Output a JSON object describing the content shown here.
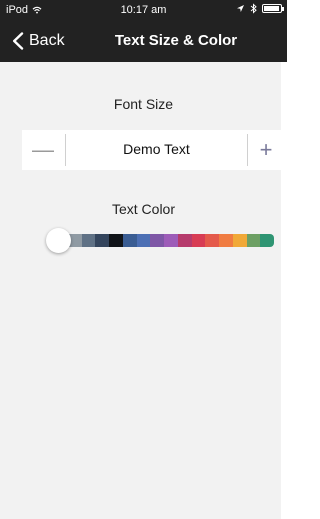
{
  "status_bar": {
    "carrier": "iPod",
    "time": "10:17 am",
    "wifi_icon": "wifi-icon",
    "location_icon": "location-arrow-icon",
    "bluetooth_icon": "bluetooth-icon",
    "battery_icon": "battery-icon"
  },
  "nav_bar": {
    "back_label": "Back",
    "back_icon": "chevron-left-icon",
    "title": "Text Size & Color"
  },
  "font_size": {
    "label": "Font Size",
    "decrease_label": "—",
    "demo_text": "Demo Text",
    "increase_label": "+"
  },
  "text_color": {
    "label": "Text Color",
    "selected_index": 0,
    "swatches": [
      "#cfd2d3",
      "#8f9aa3",
      "#5f7185",
      "#34455d",
      "#111419",
      "#3a5d93",
      "#4c6fb4",
      "#7e57a6",
      "#9d5cb8",
      "#b63b6c",
      "#d83c54",
      "#e45a4b",
      "#f07c42",
      "#f1a938",
      "#6da064",
      "#2f9573"
    ]
  },
  "colors": {
    "bar_background": "#222222",
    "screen_background": "#f2f2f2",
    "row_background": "#ffffff"
  }
}
